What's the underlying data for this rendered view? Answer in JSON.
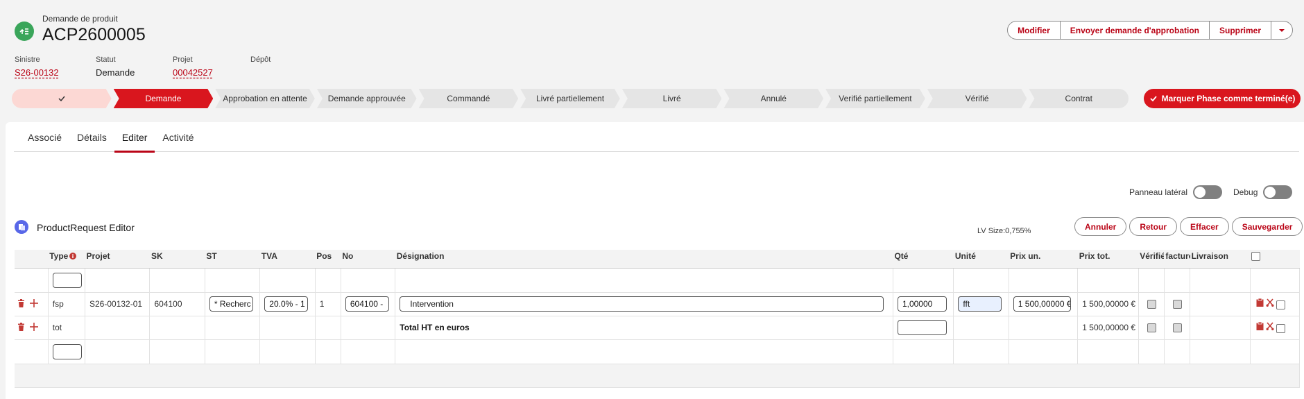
{
  "header": {
    "object_type": "Demande de produit",
    "title": "ACP2600005",
    "buttons": {
      "edit": "Modifier",
      "approval": "Envoyer demande d'approbation",
      "delete": "Supprimer"
    },
    "fields": [
      {
        "label": "Sinistre",
        "value": "S26-00132",
        "link": true
      },
      {
        "label": "Statut",
        "value": "Demande",
        "link": false
      },
      {
        "label": "Projet",
        "value": "00042527",
        "link": true
      },
      {
        "label": "Dépôt",
        "value": "",
        "link": false
      }
    ]
  },
  "path": {
    "steps": [
      "Demande",
      "Approbation en attente",
      "Demande approuvée",
      "Commandé",
      "Livré partiellement",
      "Livré",
      "Annulé",
      "Verifié partiellement",
      "Vérifié",
      "Contrat"
    ],
    "active_index": 0,
    "mark_button": "Marquer Phase comme terminé(e)"
  },
  "tabs": [
    "Associé",
    "Détails",
    "Editer",
    "Activité"
  ],
  "active_tab": "Editer",
  "toggles": {
    "side_panel": "Panneau latéral",
    "debug": "Debug"
  },
  "editor": {
    "title": "ProductRequest Editor",
    "lv_size": "LV Size:0,755%",
    "buttons": {
      "cancel": "Annuler",
      "back": "Retour",
      "clear": "Effacer",
      "save": "Sauvegarder"
    }
  },
  "grid": {
    "columns": [
      "Type",
      "Projet",
      "SK",
      "ST",
      "TVA",
      "Pos",
      "No",
      "Désignation",
      "Qté",
      "Unité",
      "Prix un.",
      "Prix tot.",
      "Vérifié",
      "facturé",
      "Livraison"
    ],
    "rows": [
      {
        "type": "fsp",
        "projet": "S26-00132-01",
        "sk": "604100",
        "st": "* Recherc",
        "tva": "20.0% - 1",
        "pos": "1",
        "no": "604100 -",
        "designation": "Intervention",
        "qte": "1,00000",
        "unite": "fft",
        "prix_un": "1 500,00000 €",
        "prix_tot": "1 500,00000 €"
      },
      {
        "type": "tot",
        "projet": "",
        "sk": "",
        "st": "",
        "tva": "",
        "pos": "",
        "no": "",
        "designation": "Total HT en euros",
        "qte": "",
        "unite": "",
        "prix_un": "",
        "prix_tot": "1 500,00000 €"
      }
    ]
  },
  "colors": {
    "brand_red": "#d9161e",
    "link_red": "#ba0517",
    "record_icon": "#3aa55a",
    "editor_icon": "#5867e8"
  }
}
